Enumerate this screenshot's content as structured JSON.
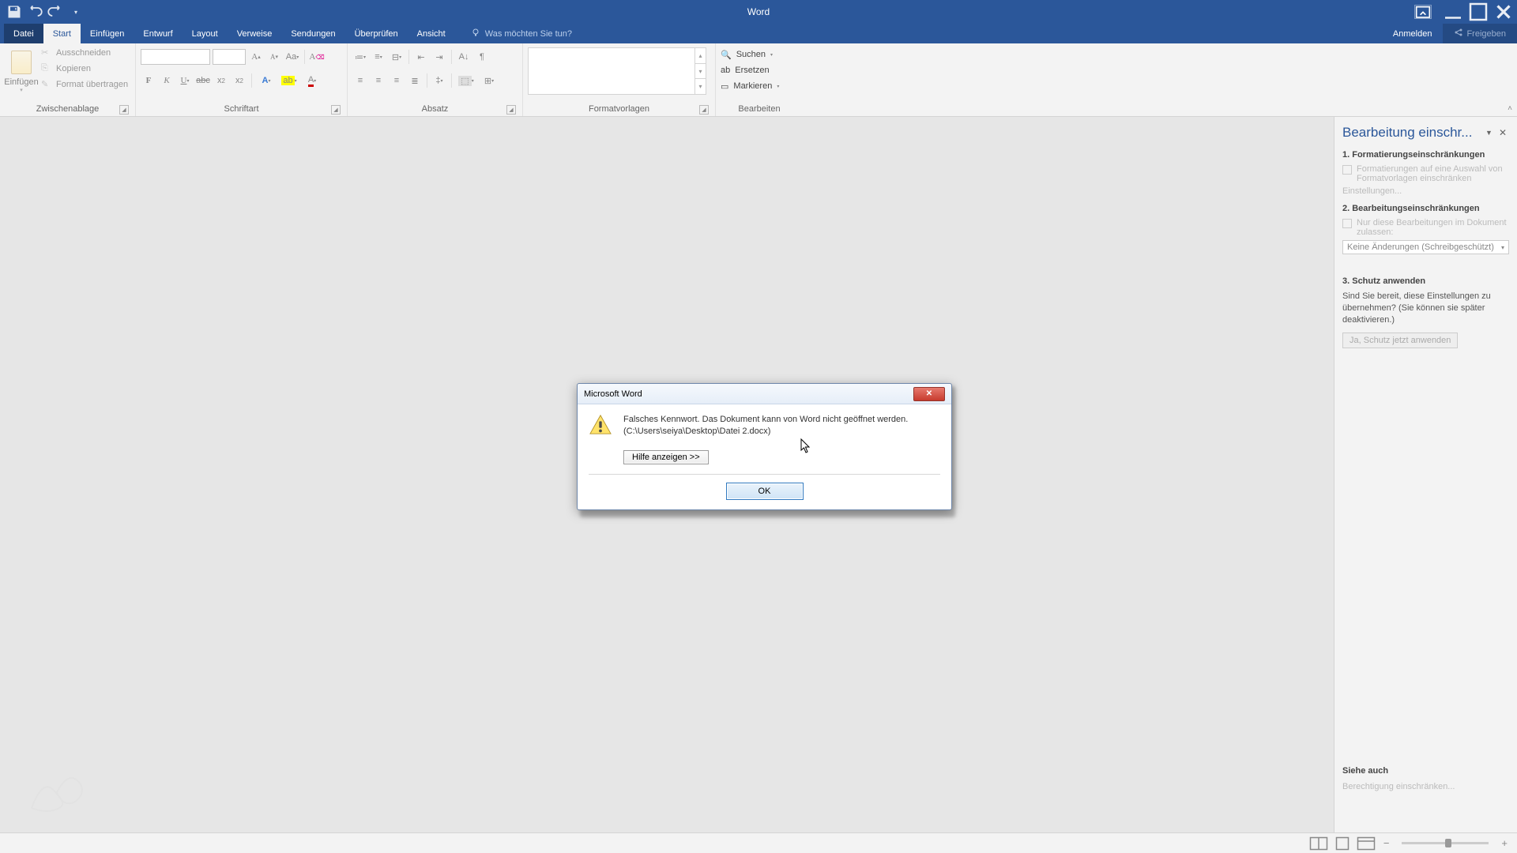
{
  "app": {
    "title": "Word"
  },
  "qat": {
    "save": "save",
    "undo": "undo",
    "redo": "redo",
    "touch": "touch-mode"
  },
  "tabs": {
    "file": "Datei",
    "start": "Start",
    "insert": "Einfügen",
    "design": "Entwurf",
    "layout": "Layout",
    "references": "Verweise",
    "mailings": "Sendungen",
    "review": "Überprüfen",
    "view": "Ansicht",
    "tell": "Was möchten Sie tun?",
    "signin": "Anmelden",
    "share": "Freigeben"
  },
  "ribbon": {
    "clipboard": {
      "label": "Zwischenablage",
      "paste": "Einfügen",
      "cut": "Ausschneiden",
      "copy": "Kopieren",
      "format_painter": "Format übertragen"
    },
    "font": {
      "label": "Schriftart"
    },
    "paragraph": {
      "label": "Absatz"
    },
    "styles": {
      "label": "Formatvorlagen"
    },
    "editing": {
      "label": "Bearbeiten",
      "find": "Suchen",
      "replace": "Ersetzen",
      "select": "Markieren"
    }
  },
  "pane": {
    "title": "Bearbeitung einschr...",
    "s1_title": "1. Formatierungseinschränkungen",
    "s1_check": "Formatierungen auf eine Auswahl von Formatvorlagen einschränken",
    "s1_link": "Einstellungen...",
    "s2_title": "2. Bearbeitungseinschränkungen",
    "s2_check": "Nur diese Bearbeitungen im Dokument zulassen:",
    "s2_value": "Keine Änderungen (Schreibgeschützt)",
    "s3_title": "3. Schutz anwenden",
    "s3_text": "Sind Sie bereit, diese Einstellungen zu übernehmen? (Sie können sie später deaktivieren.)",
    "s3_button": "Ja, Schutz jetzt anwenden",
    "see_also_title": "Siehe auch",
    "see_also_link": "Berechtigung einschränken..."
  },
  "dialog": {
    "title": "Microsoft Word",
    "message": "Falsches Kennwort. Das Dokument kann von Word nicht geöffnet werden.",
    "path": "(C:\\Users\\seiya\\Desktop\\Datei 2.docx)",
    "help": "Hilfe anzeigen >>",
    "ok": "OK"
  }
}
